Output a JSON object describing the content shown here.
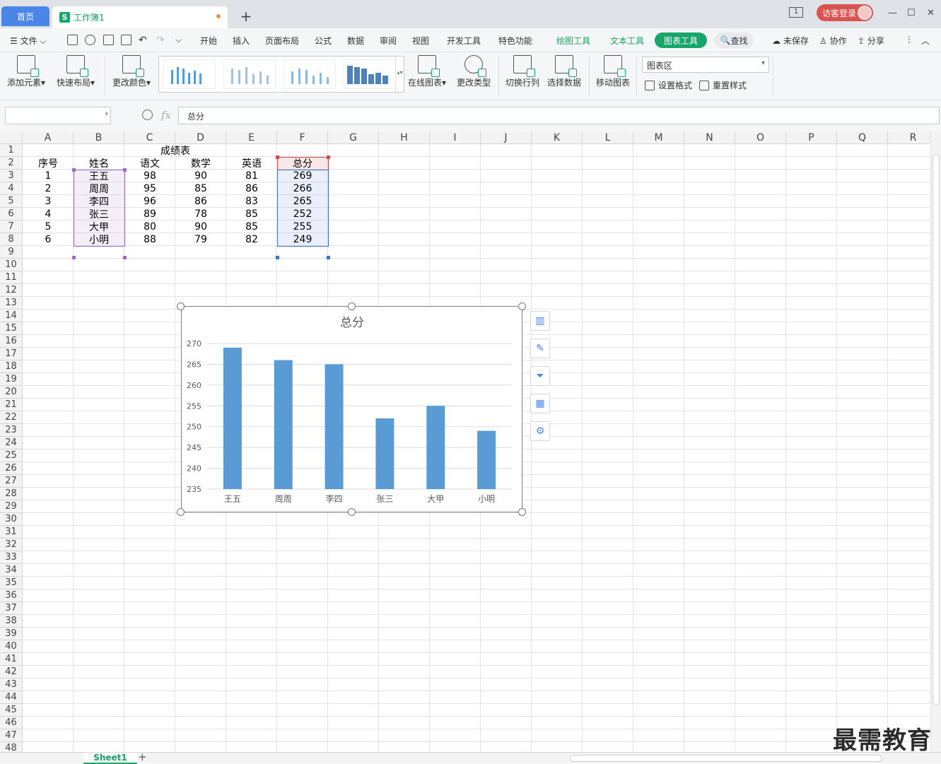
{
  "titlebar": {
    "home_tab": "首页",
    "doc_tab": "工作簿1",
    "doc_icon": "S",
    "page_badge": "1",
    "login_label": "访客登录"
  },
  "menu": {
    "file": "文件",
    "items": [
      "开始",
      "插入",
      "页面布局",
      "公式",
      "数据",
      "审阅",
      "视图",
      "开发工具",
      "特色功能"
    ],
    "draw_tools": "绘图工具",
    "text_tools": "文本工具",
    "chart_tools": "图表工具",
    "search": "查找",
    "unsaved": "未保存",
    "collab": "协作",
    "share": "分享"
  },
  "ribbon": {
    "add_element": "添加元素",
    "quick_layout": "快速布局",
    "change_color": "更改颜色",
    "online_chart": "在线图表",
    "change_type": "更改类型",
    "switch_row_col": "切换行列",
    "select_data": "选择数据",
    "move_chart": "移动图表",
    "chart_area": "图表区",
    "set_format": "设置格式",
    "reset_style": "重置样式"
  },
  "formula": {
    "name_box": "",
    "content": "总分"
  },
  "columns": [
    "A",
    "B",
    "C",
    "D",
    "E",
    "F",
    "G",
    "H",
    "I",
    "J",
    "K",
    "L",
    "M",
    "N",
    "O",
    "P",
    "Q",
    "R"
  ],
  "table": {
    "title": "成绩表",
    "headers": [
      "序号",
      "姓名",
      "语文",
      "数学",
      "英语",
      "总分"
    ],
    "rows": [
      [
        "1",
        "王五",
        "98",
        "90",
        "81",
        "269"
      ],
      [
        "2",
        "周周",
        "95",
        "85",
        "86",
        "266"
      ],
      [
        "3",
        "李四",
        "96",
        "86",
        "83",
        "265"
      ],
      [
        "4",
        "张三",
        "89",
        "78",
        "85",
        "252"
      ],
      [
        "5",
        "大甲",
        "80",
        "90",
        "85",
        "255"
      ],
      [
        "6",
        "小明",
        "88",
        "79",
        "82",
        "249"
      ]
    ]
  },
  "chart_data": {
    "type": "bar",
    "title": "总分",
    "categories": [
      "王五",
      "周周",
      "李四",
      "张三",
      "大甲",
      "小明"
    ],
    "values": [
      269,
      266,
      265,
      252,
      255,
      249
    ],
    "ylim": [
      235,
      270
    ],
    "yticks": [
      235,
      240,
      245,
      250,
      255,
      260,
      265,
      270
    ],
    "grid": true,
    "bar_color": "#5b9bd5"
  },
  "sheets": {
    "active": "Sheet1"
  },
  "watermark": "最需教育",
  "colors": {
    "accent_green": "#1aa56b",
    "home_blue": "#4a86e8",
    "login_red": "#d9534f"
  }
}
